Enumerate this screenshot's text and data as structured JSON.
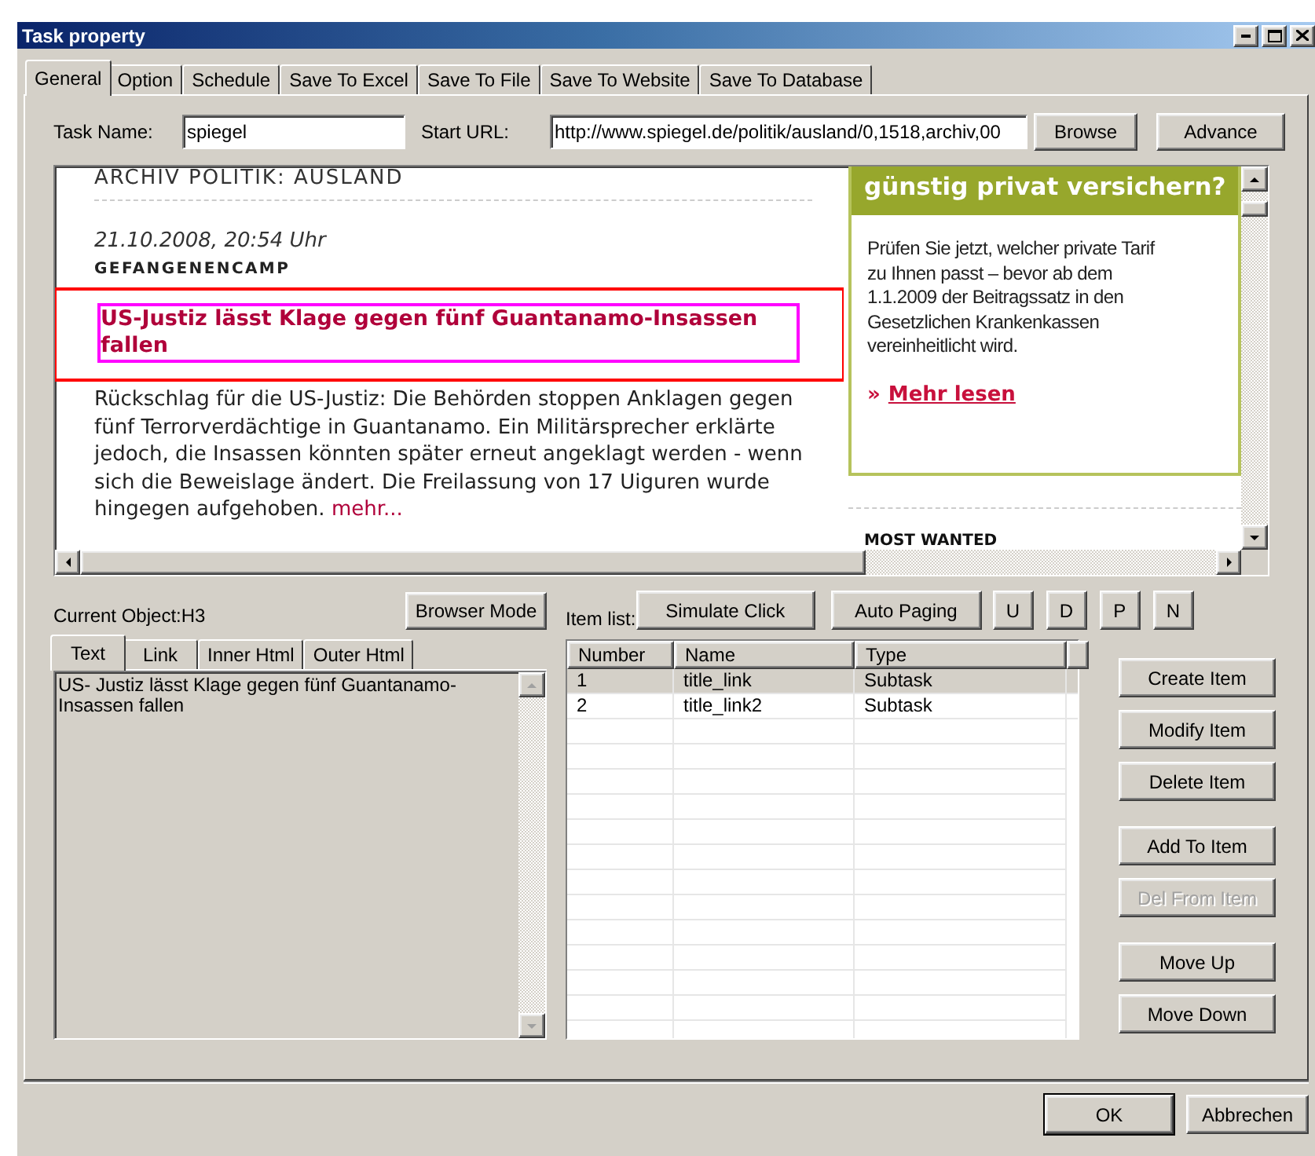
{
  "window": {
    "title": "Task property"
  },
  "tabs": [
    {
      "label": "General",
      "selected": true
    },
    {
      "label": "Option",
      "selected": false
    },
    {
      "label": "Schedule",
      "selected": false
    },
    {
      "label": "Save To Excel",
      "selected": false
    },
    {
      "label": "Save To File",
      "selected": false
    },
    {
      "label": "Save To Website",
      "selected": false
    },
    {
      "label": "Save To Database",
      "selected": false
    }
  ],
  "task_name": {
    "label": "Task Name:",
    "value": "spiegel"
  },
  "start_url": {
    "label": "Start URL:",
    "value": "http://www.spiegel.de/politik/ausland/0,1518,archiv,00"
  },
  "url_buttons": [
    "Browse",
    "Advance"
  ],
  "browser": {
    "article": {
      "section_heading": "ARCHIV POLITIK: AUSLAND",
      "dateline": "21.10.2008, 20:54 Uhr",
      "kicker": "GEFANGENENCAMP",
      "headline": "US-Justiz lässt Klage gegen fünf Guantanamo-Insassen fallen",
      "body": "Rückschlag für die US-Justiz: Die Behörden stoppen Anklagen gegen fünf Terrorverdächtige in Guantanamo. Ein Militärsprecher erklärte jedoch, die Insassen könnten später erneut angeklagt werden - wenn sich die Beweislage ändert. Die Freilassung von 17 Uiguren wurde hingegen aufgehoben.",
      "more_link": "mehr..."
    },
    "ad": {
      "title": "günstig privat versichern?",
      "body": "Prüfen Sie jetzt, welcher private Tarif zu Ihnen passt – bevor ab dem 1.1.2009 der Beitragssatz in den Gesetzlichen Krankenkassen vereinheitlicht wird.",
      "link_marker": "»",
      "link": "Mehr lesen"
    },
    "sidebar_heading": "MOST WANTED"
  },
  "current_object": "Current Object:H3",
  "browser_mode_button": "Browser Mode",
  "detail_tabs": [
    {
      "label": "Text",
      "selected": true
    },
    {
      "label": "Link",
      "selected": false
    },
    {
      "label": "Inner Html",
      "selected": false
    },
    {
      "label": "Outer Html",
      "selected": false
    }
  ],
  "detail_text": "US- Justiz lässt Klage gegen fünf Guantanamo-Insassen fallen",
  "item_list": {
    "label": "Item list:",
    "buttons": [
      "Simulate Click",
      "Auto Paging",
      "U",
      "D",
      "P",
      "N"
    ],
    "columns": [
      "Number",
      "Name",
      "Type"
    ],
    "rows": [
      {
        "cells": [
          "1",
          "title_link",
          "Subtask"
        ],
        "selected": true
      },
      {
        "cells": [
          "2",
          "title_link2",
          "Subtask"
        ],
        "selected": false
      }
    ]
  },
  "side_buttons": [
    {
      "label": "Create Item",
      "disabled": false
    },
    {
      "label": "Modify Item",
      "disabled": false
    },
    {
      "label": "Delete Item",
      "disabled": false
    },
    {
      "label": "Add To Item",
      "disabled": false
    },
    {
      "label": "Del From Item",
      "disabled": true
    },
    {
      "label": "Move Up",
      "disabled": false
    },
    {
      "label": "Move Down",
      "disabled": false
    }
  ],
  "dialog_buttons": [
    {
      "label": "OK",
      "default": true
    },
    {
      "label": "Abbrechen",
      "default": false
    }
  ]
}
